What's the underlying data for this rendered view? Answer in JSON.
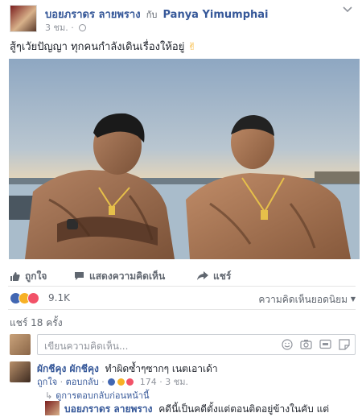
{
  "post": {
    "author": "บอยภราดร ลายพราง",
    "with_word": "กับ",
    "tagged": "Panya Yimumphai",
    "time": "3 ชม.",
    "text": "สู้ๆเวัยปัญญา ทุกคนกำลังเดินเรื่องให้อยู่"
  },
  "actions": {
    "like": "ถูกใจ",
    "comment": "แสดงความคิดเห็น",
    "share": "แชร์"
  },
  "reactions": {
    "count": "9.1K",
    "top_comments": "ความคิดเห็นยอดนิยม",
    "shares": "แชร์ 18 ครั้ง",
    "colors": {
      "like": "#4267b2",
      "haha": "#f7b125",
      "love": "#f25268"
    }
  },
  "comment_box": {
    "placeholder": "เขียนความคิดเห็น..."
  },
  "comments": [
    {
      "author": "ผักชีคุง ผักชีคุง",
      "text": "ทำผิดซ้ำๆซากๆ เนตเอาเด้า",
      "like": "ถูกใจ",
      "reply": "ตอบกลับ",
      "reaction_count": "174",
      "time": "3 ชม."
    }
  ],
  "previous_replies": "ดูการตอบกลับก่อนหน้านี้",
  "reply": {
    "author": "บอยภราดร ลายพราง",
    "text": "คดีนี้เป็นคดีตั้งแต่ตอนติดอยู่ข้างในคับ แต่"
  }
}
